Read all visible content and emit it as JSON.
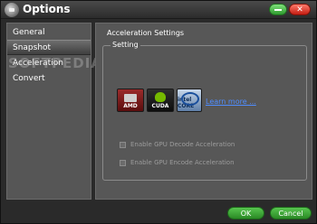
{
  "window": {
    "title": "Options"
  },
  "sidebar": {
    "items": [
      {
        "label": "General"
      },
      {
        "label": "Snapshot"
      },
      {
        "label": "Acceleration"
      },
      {
        "label": "Convert"
      }
    ]
  },
  "watermark": "SOFTPEDIA",
  "main": {
    "title": "Acceleration Settings",
    "group_label": "Setting",
    "logos": [
      {
        "label": "AMD"
      },
      {
        "label": "CUDA"
      },
      {
        "label": "intel CORE"
      }
    ],
    "learn_more": "Learn more ...",
    "options": [
      {
        "label": "Enable GPU Decode Acceleration"
      },
      {
        "label": "Enable GPU Encode Acceleration"
      }
    ]
  },
  "buttons": {
    "ok": "OK",
    "cancel": "Cancel"
  },
  "colors": {
    "accent": "#3aa833",
    "link": "#4f8dff",
    "close": "#d9261a"
  }
}
